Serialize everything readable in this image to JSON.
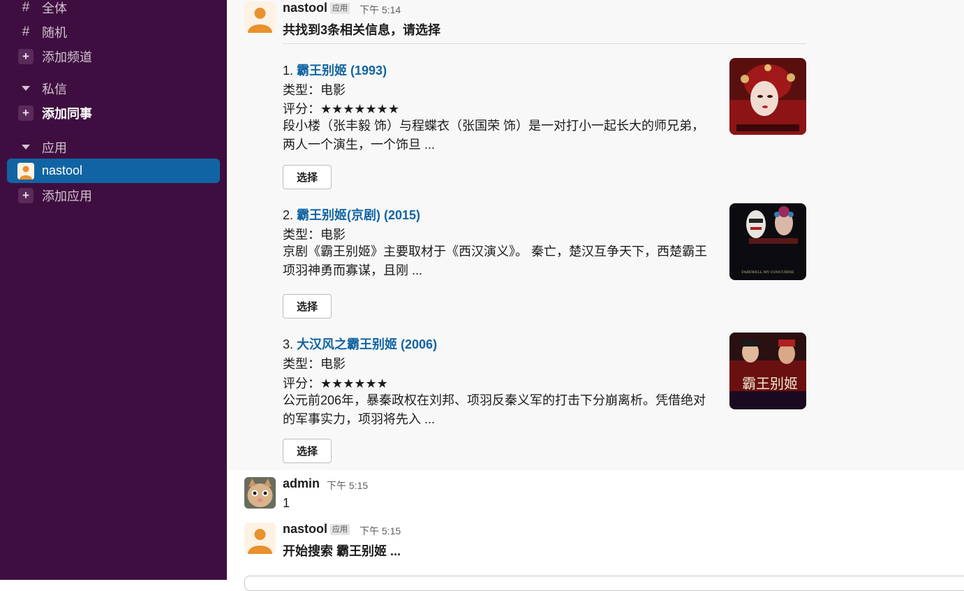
{
  "sidebar": {
    "channels": [
      {
        "icon": "hash-icon",
        "label": "全体"
      },
      {
        "icon": "hash-icon",
        "label": "随机"
      },
      {
        "icon": "plus-icon",
        "label": "添加频道"
      }
    ],
    "dm_section": "私信",
    "add_colleague": "添加同事",
    "apps_section": "应用",
    "active_app": "nastool",
    "add_app": "添加应用"
  },
  "messages": [
    {
      "sender": "nastool",
      "badge": "应用",
      "time": "下午 5:14",
      "text": "共找到3条相关信息，请选择",
      "results": [
        {
          "index": "1.",
          "title": "霸王别姬 (1993)",
          "type": "类型：电影",
          "rating": "评分：★★★★★★★",
          "desc": "段小楼（张丰毅 饰）与程蝶衣（张国荣 饰）是一对打小一起长大的师兄弟，两人一个演生，一个饰旦 ...",
          "button": "选择"
        },
        {
          "index": "2.",
          "title": "霸王别姬(京剧) (2015)",
          "type": "类型：电影",
          "desc": "京剧《霸王别姬》主要取材于《西汉演义》。 秦亡，楚汉互争天下，西楚霸王项羽神勇而寡谋，且刚 ...",
          "button": "选择",
          "poster_caption": "FAREWELL MY CONCUBINE"
        },
        {
          "index": "3.",
          "title": "大汉风之霸王别姬 (2006)",
          "type": "类型：电影",
          "rating": "评分：★★★★★★",
          "desc": "公元前206年，暴秦政权在刘邦、项羽反秦义军的打击下分崩离析。凭借绝对的军事实力，项羽将先入 ...",
          "button": "选择",
          "poster_caption": "霸王别姬"
        }
      ]
    },
    {
      "sender": "admin",
      "time": "下午 5:15",
      "text": "1"
    },
    {
      "sender": "nastool",
      "badge": "应用",
      "time": "下午 5:15",
      "text": "开始搜索 霸王别姬 ..."
    }
  ],
  "colors": {
    "sidebar_bg": "#3f0e40",
    "active_item": "#1164a3",
    "link": "#1264a3"
  }
}
